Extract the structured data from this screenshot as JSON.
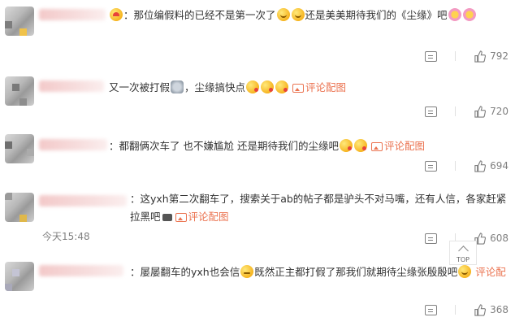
{
  "comments": [
    {
      "segments": [
        "：那位编假料的已经不是第一次了",
        "还是美美期待我们的《尘缘》吧"
      ],
      "likes": "792"
    },
    {
      "segments": [
        "又一次被打假",
        "，尘缘搞快点"
      ],
      "link": "评论配图",
      "likes": "720"
    },
    {
      "segments": [
        "：都翻俩次车了 也不嫌尴尬 还是期待我们的尘缘吧"
      ],
      "link": "评论配图",
      "likes": "694"
    },
    {
      "segments": [
        "：这yxh第二次翻车了，搜索关于ab的帖子都是驴头不对马嘴，还有人信，各家赶紧拉黑吧"
      ],
      "link": "评论配图",
      "timestamp": "今天15:48",
      "likes": "608"
    },
    {
      "segments": [
        "：屡屡翻车的yxh也会信",
        "既然正主都打假了那我们就期待尘缘张殷殷吧"
      ],
      "link": "评论配",
      "likes": "368"
    }
  ],
  "scroll_top": {
    "label": "TOP"
  },
  "colors": {
    "link": "#eb7350",
    "meta": "#808080"
  }
}
